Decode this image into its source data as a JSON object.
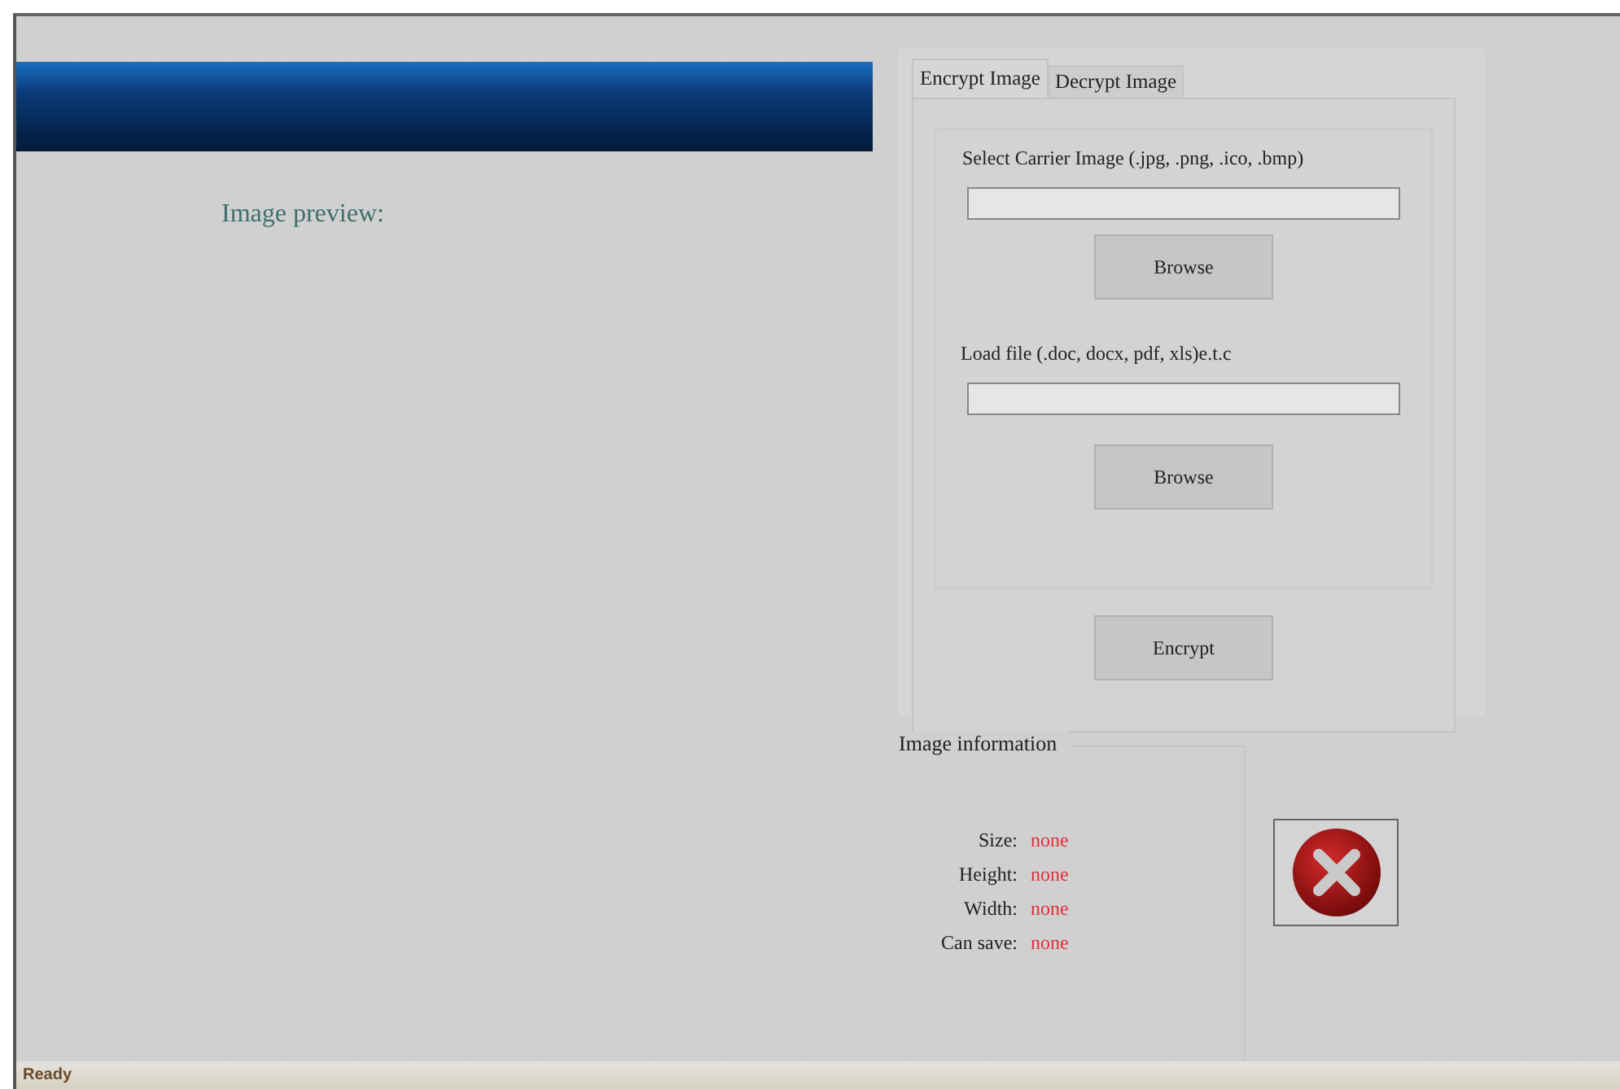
{
  "preview": {
    "label": "Image preview:"
  },
  "tabs": [
    {
      "label": "Encrypt Image",
      "selected": true
    },
    {
      "label": "Decrypt Image",
      "selected": false
    }
  ],
  "encrypt": {
    "carrier_label": "Select Carrier Image (.jpg, .png, .ico, .bmp)",
    "carrier_button": "Browse",
    "file_label": "Load file (.doc, docx, pdf, xls)e.t.c",
    "file_button": "Browse",
    "encrypt_button": "Encrypt"
  },
  "image_information": {
    "title": "Image information",
    "rows": [
      {
        "label": "Size:",
        "value": "none"
      },
      {
        "label": "Height:",
        "value": "none"
      },
      {
        "label": "Width:",
        "value": "none"
      },
      {
        "label": "Can save:",
        "value": "none"
      }
    ]
  },
  "status_bar": "Ready"
}
